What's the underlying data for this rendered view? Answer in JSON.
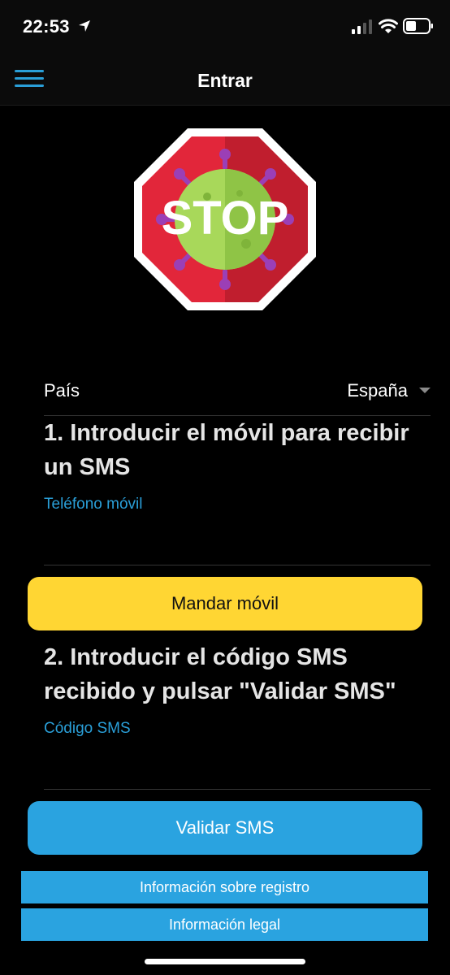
{
  "status_bar": {
    "time": "22:53"
  },
  "nav": {
    "title": "Entrar"
  },
  "logo": {
    "text": "STOP"
  },
  "country": {
    "label": "País",
    "value": "España"
  },
  "step1": {
    "title": "1. Introducir el móvil para recibir un SMS",
    "field_label": "Teléfono móvil",
    "field_value": "",
    "button_label": "Mandar móvil"
  },
  "step2": {
    "title": "2. Introducir el código SMS recibido y pulsar \"Validar SMS\"",
    "field_label": "Código SMS",
    "field_value": "",
    "button_label": "Validar SMS"
  },
  "links": {
    "registro": "Información sobre registro",
    "legal": "Información legal"
  },
  "colors": {
    "accent_blue": "#2aa3e0",
    "accent_yellow": "#ffd633",
    "stop_red": "#d0202e"
  }
}
